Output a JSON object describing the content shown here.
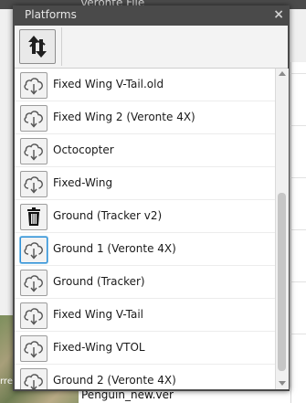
{
  "dialog": {
    "title": "Platforms",
    "close_glyph": "×"
  },
  "toolbar": {
    "sync_icon": "sync-arrows-icon"
  },
  "background": {
    "window_title_fragment": "Veronte File",
    "map_label": "rrel",
    "file_name": "Penguin_new.ver"
  },
  "platforms": [
    {
      "label": "Fixed Wing V-Tail.old",
      "icon": "cloud-download-icon"
    },
    {
      "label": "Fixed Wing 2 (Veronte 4X)",
      "icon": "cloud-download-icon"
    },
    {
      "label": "Octocopter",
      "icon": "cloud-download-icon"
    },
    {
      "label": "Fixed-Wing",
      "icon": "cloud-download-icon"
    },
    {
      "label": "Ground (Tracker v2)",
      "icon": "trash-icon"
    },
    {
      "label": "Ground 1 (Veronte 4X)",
      "icon": "cloud-download-icon"
    },
    {
      "label": "Ground (Tracker)",
      "icon": "cloud-download-icon"
    },
    {
      "label": "Fixed Wing V-Tail",
      "icon": "cloud-download-icon"
    },
    {
      "label": "Fixed-Wing VTOL",
      "icon": "cloud-download-icon"
    },
    {
      "label": "Ground 2 (Veronte 4X)",
      "icon": "cloud-download-icon"
    }
  ],
  "colors": {
    "titlebar": "#4a4a4a",
    "focus_border": "#2f8fd6"
  }
}
